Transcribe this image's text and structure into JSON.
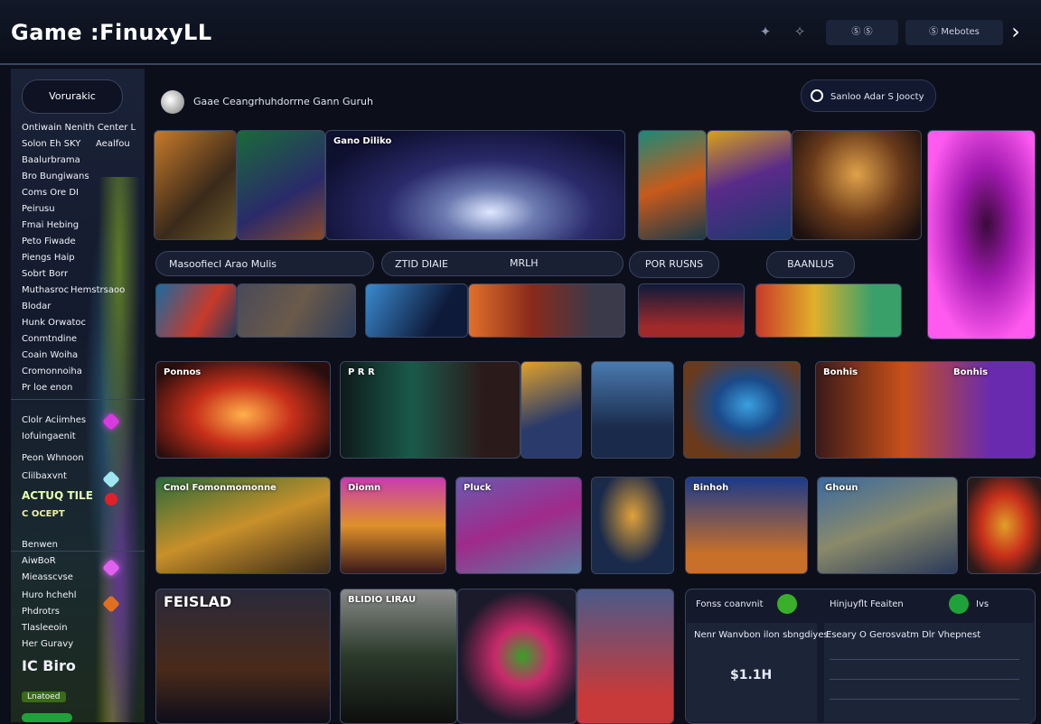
{
  "topbar": {
    "app_title": "Game :FinuxyLL",
    "icons": [
      "controller-icon",
      "bell-icon"
    ],
    "pill_left": "Ⓢ Ⓢ",
    "pill_right": "Ⓢ Mebotes",
    "next_arrow": "›"
  },
  "sidebar": {
    "header": "Vorurakic",
    "items": [
      "Ontiwain Nenith Center L",
      "Solon Eh SKY",
      "Aealfou",
      "Baalurbrama",
      "Bro Bungiwans",
      "Coms Ore DI",
      "Peirusu",
      "Fmai Hebing",
      "Peto Fiwade",
      "Piengs Haip",
      "Sobrt Borr",
      "Muthasroc",
      "Hemstrsaoo",
      "Blodar",
      "Hunk Orwatoc",
      "Conmtndine",
      "Coain Woiha",
      "Cromonnoiha",
      "Pr loe enon"
    ],
    "items2": [
      "Clolr Aciimhes",
      "Iofuingaenit",
      "Peon Whnoon",
      "Clilbaxvnt",
      "ACTUQ TILE",
      "C OCEPT",
      "Benwen",
      "AiwBoR",
      "Mieasscvse",
      "Huro hchehl",
      "Phdrotrs",
      "Tlasleeoin",
      "Her Guravy",
      "IC Biro",
      "Lnatoed"
    ]
  },
  "main": {
    "header_title": "Gaae Ceangrhuhdorrne Gann Guruh",
    "search_placeholder": "Sanloo Adar S Joocty",
    "hero_label": "Gano Diliko",
    "tabs": [
      "Masoofiecl Arao Mulis",
      "ZTID DIAIE",
      "MRLH",
      "POR RUSNS",
      "BAANLUS"
    ],
    "row2_labels": [
      "Ponnos",
      "P R R",
      "Bonhis",
      "Bonhis"
    ],
    "row3_labels": [
      "Cmol Fomonmomonne",
      "Diomn",
      "Pluck",
      "Binhoh",
      "Ghoun"
    ],
    "row4_labels": [
      "FEISLAD",
      "BLIDIO LIRAU"
    ]
  },
  "panel": {
    "title_left": "Fonss coanvnit",
    "title_right": "Hinjuyflt Feaiten",
    "badge": "Ivs",
    "line_left": "Nenr Wanvbon ilon sbngdiyes",
    "line_right": "Eseary O Gerosvatm Dlr Vhepnest",
    "value": "$1.1H"
  },
  "colors": {
    "background": "#0c0f1a",
    "accent_green": "#1fa23a",
    "accent_magenta": "#d83ae0",
    "border": "#3a4560"
  }
}
